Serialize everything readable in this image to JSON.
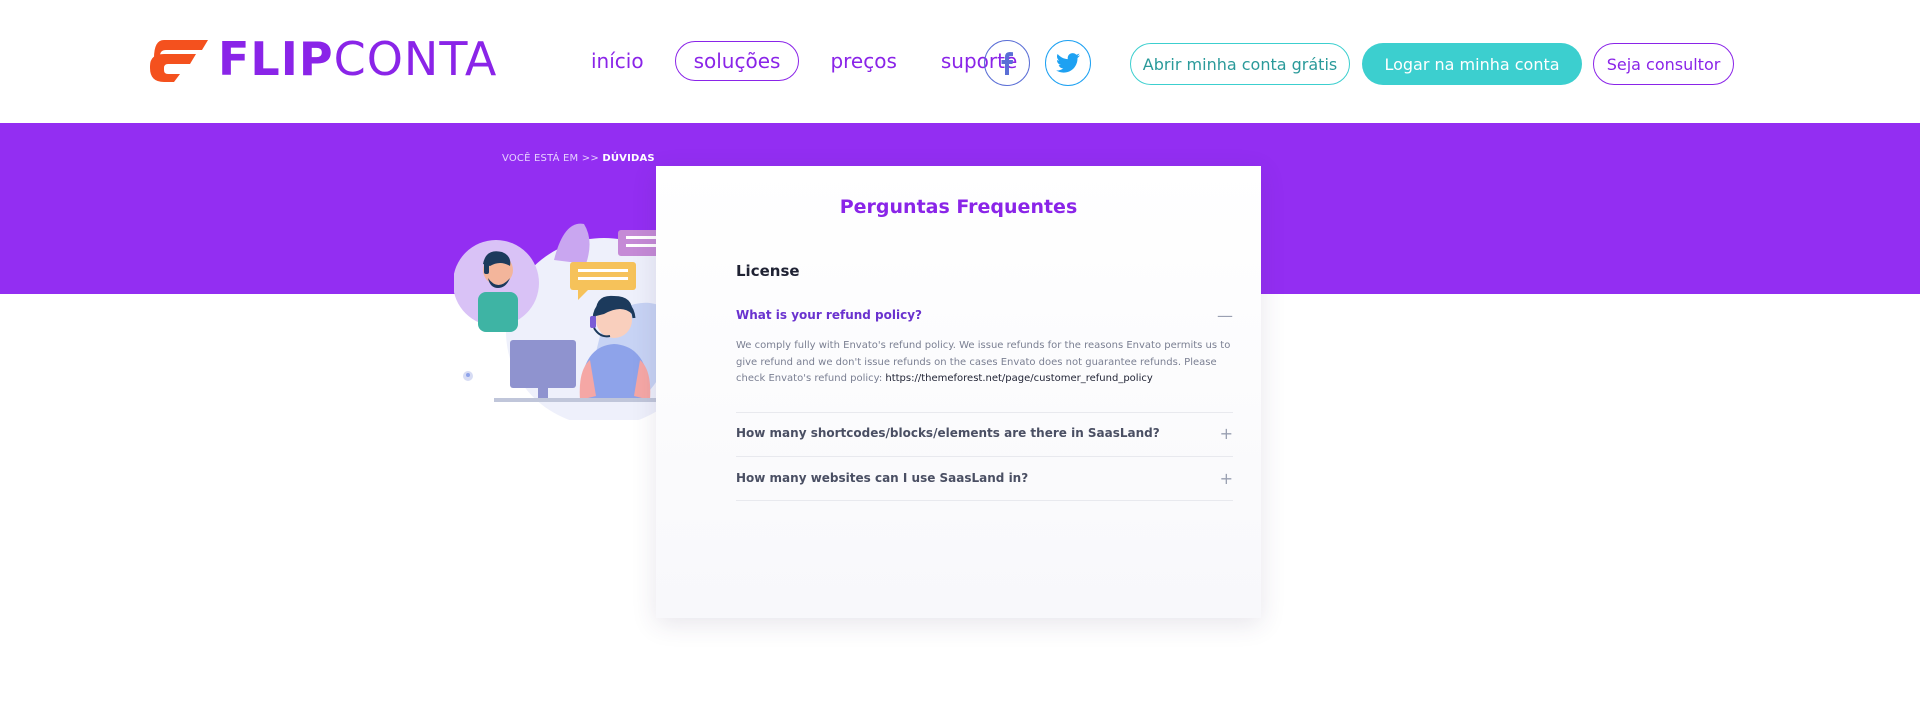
{
  "logo": {
    "part1": "FLIP",
    "part2": "CONTA"
  },
  "nav": {
    "items": [
      {
        "label": "início",
        "active": false
      },
      {
        "label": "soluções",
        "active": true
      },
      {
        "label": "preços",
        "active": false
      },
      {
        "label": "suporte",
        "active": false
      }
    ]
  },
  "social": {
    "facebook": "facebook-icon",
    "twitter": "twitter-icon"
  },
  "buttons": {
    "open_account": "Abrir minha conta grátis",
    "login": "Logar na minha conta",
    "consultant": "Seja consultor"
  },
  "breadcrumb": {
    "prefix": "VOCÊ ESTÁ EM >>",
    "current": "DÚVIDAS"
  },
  "faq": {
    "title": "Perguntas Frequentes",
    "section": "License",
    "items": [
      {
        "question": "What is your refund policy?",
        "open": true,
        "answer": "We comply fully with Envato's refund policy. We issue refunds for the reasons Envato permits us to give refund and we don't issue refunds on the cases Envato does not guarantee refunds. Please check Envato's refund policy:",
        "link": "https://themeforest.net/page/customer_refund_policy"
      },
      {
        "question": "How many shortcodes/blocks/elements are there in SaasLand?",
        "open": false
      },
      {
        "question": "How many websites can I use SaasLand in?",
        "open": false
      }
    ]
  },
  "colors": {
    "brand_purple": "#8a24e8",
    "banner_purple": "#932ef2",
    "teal": "#3ccfcf",
    "logo_orange": "#f4511e"
  }
}
